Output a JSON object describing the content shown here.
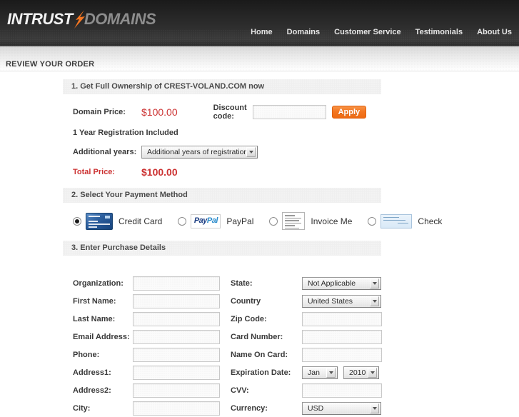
{
  "header": {
    "logo_primary": "INTRUST",
    "logo_secondary": "DOMAINS",
    "nav": [
      {
        "label": "Home"
      },
      {
        "label": "Domains"
      },
      {
        "label": "Customer Service"
      },
      {
        "label": "Testimonials"
      },
      {
        "label": "About Us"
      }
    ]
  },
  "page": {
    "title": "REVIEW YOUR ORDER"
  },
  "section1": {
    "heading": "1. Get Full Ownership of CREST-VOLAND.COM now",
    "domain_price_label": "Domain Price:",
    "domain_price_value": "$100.00",
    "discount_label": "Discount code:",
    "discount_value": "",
    "discount_placeholder": "",
    "apply_label": "Apply",
    "registration_note": "1 Year Registration Included",
    "additional_years_label": "Additional years:",
    "additional_years_value": "Additional years of registration",
    "total_label": "Total Price:",
    "total_value": "$100.00"
  },
  "section2": {
    "heading": "2. Select Your Payment Method",
    "options": [
      {
        "label": "Credit Card",
        "icon": "credit-card-icon",
        "selected": true
      },
      {
        "label": "PayPal",
        "icon": "paypal-icon",
        "selected": false
      },
      {
        "label": "Invoice Me",
        "icon": "invoice-icon",
        "selected": false
      },
      {
        "label": "Check",
        "icon": "check-icon",
        "selected": false
      }
    ],
    "paypal_logo_pay": "Pay",
    "paypal_logo_pal": "Pal"
  },
  "section3": {
    "heading": "3. Enter Purchase Details",
    "left_fields": [
      {
        "label": "Organization:",
        "value": "",
        "type": "text"
      },
      {
        "label": "First Name:",
        "value": "",
        "type": "text"
      },
      {
        "label": "Last Name:",
        "value": "",
        "type": "text"
      },
      {
        "label": "Email Address:",
        "value": "",
        "type": "text"
      },
      {
        "label": "Phone:",
        "value": "",
        "type": "text"
      },
      {
        "label": "Address1:",
        "value": "",
        "type": "text"
      },
      {
        "label": "Address2:",
        "value": "",
        "type": "text"
      },
      {
        "label": "City:",
        "value": "",
        "type": "text"
      }
    ],
    "right_fields": [
      {
        "label": "State:",
        "value": "Not Applicable",
        "type": "select"
      },
      {
        "label": "Country",
        "value": "United States",
        "type": "select"
      },
      {
        "label": "Zip Code:",
        "value": "",
        "type": "text"
      },
      {
        "label": "Card Number:",
        "value": "",
        "type": "text"
      },
      {
        "label": "Name On Card:",
        "value": "",
        "type": "text"
      },
      {
        "label": "Expiration Date:",
        "value": "Jan",
        "value2": "2010",
        "type": "select2"
      },
      {
        "label": "CVV:",
        "value": "",
        "type": "text-small"
      },
      {
        "label": "Currency:",
        "value": "USD",
        "type": "select"
      }
    ]
  },
  "colors": {
    "accent_orange": "#f47621",
    "price_red": "#cc3333",
    "header_dark": "#262626",
    "logo_gray": "#8d8d8d"
  }
}
